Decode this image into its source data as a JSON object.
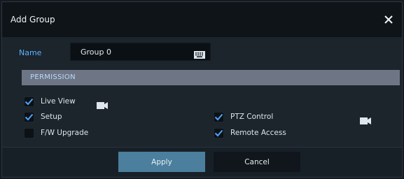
{
  "dialog": {
    "title": "Add Group",
    "close_icon": "close-icon"
  },
  "name_field": {
    "label": "Name",
    "value": "Group 0",
    "icon": "keyboard-icon"
  },
  "permission": {
    "header": "PERMISSION",
    "items": [
      {
        "label": "Live View",
        "checked": true,
        "icon": "camera-icon"
      },
      {
        "label": "Setup",
        "checked": true
      },
      {
        "label": "F/W Upgrade",
        "checked": false
      },
      {
        "label": "PTZ Control",
        "checked": true,
        "icon": "camera-icon"
      },
      {
        "label": "Remote Access",
        "checked": true
      }
    ]
  },
  "buttons": {
    "apply": "Apply",
    "cancel": "Cancel"
  },
  "colors": {
    "accent": "#5ab4ff",
    "check": "#4ea3ff",
    "header_bg": "#6e7686",
    "apply_bg": "#4b7f9d"
  }
}
